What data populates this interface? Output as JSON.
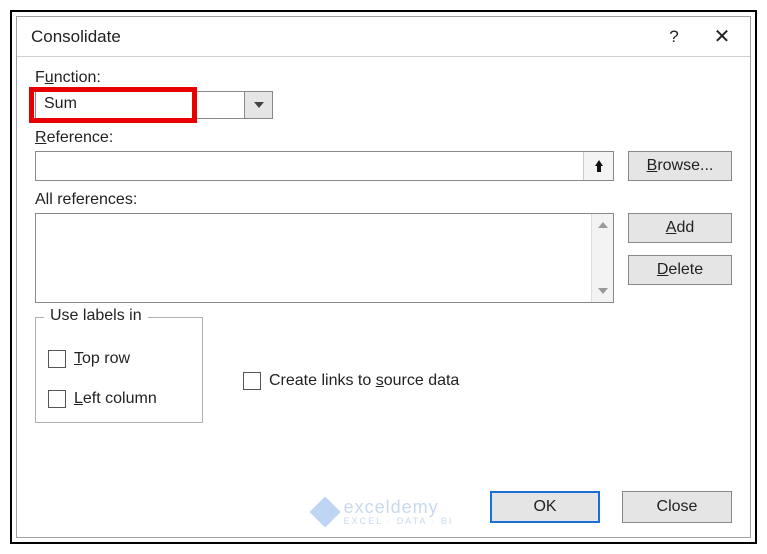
{
  "dialog": {
    "title": "Consolidate",
    "help_symbol": "?",
    "close_symbol": "✕"
  },
  "function": {
    "label_pre": "F",
    "label_und": "u",
    "label_post": "nction:",
    "selected": "Sum"
  },
  "reference": {
    "label_und": "R",
    "label_post": "eference:",
    "value": ""
  },
  "all_references": {
    "label": "All references:"
  },
  "buttons": {
    "browse_und": "B",
    "browse_post": "rowse...",
    "add_und": "A",
    "add_post": "dd",
    "delete_und": "D",
    "delete_post": "elete",
    "ok": "OK",
    "close": "Close"
  },
  "labels_group": {
    "legend": "Use labels in",
    "top_row_und": "T",
    "top_row_post": "op row",
    "left_col_und": "L",
    "left_col_post": "eft column",
    "create_links_pre": "Create links to ",
    "create_links_und": "s",
    "create_links_post": "ource data"
  },
  "watermark": {
    "brand": "exceldemy",
    "tag": "EXCEL · DATA · BI"
  }
}
